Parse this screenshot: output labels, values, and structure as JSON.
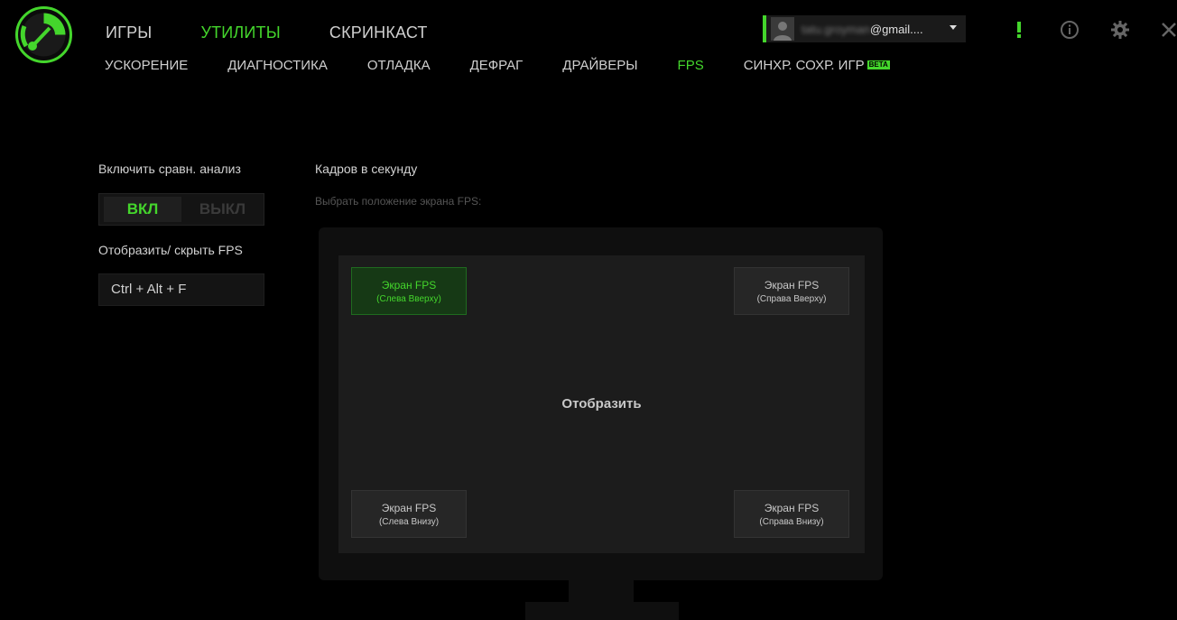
{
  "colors": {
    "accent": "#44d62c",
    "background": "#000000"
  },
  "top_nav": [
    {
      "label": "ИГРЫ",
      "active": false
    },
    {
      "label": "УТИЛИТЫ",
      "active": true
    },
    {
      "label": "СКРИНКАСТ",
      "active": false
    }
  ],
  "sub_nav": {
    "items": [
      {
        "label": "УСКОРЕНИЕ"
      },
      {
        "label": "ДИАГНОСТИКА"
      },
      {
        "label": "ОТЛАДКА"
      },
      {
        "label": "ДЕФРАГ"
      },
      {
        "label": "ДРАЙВЕРЫ"
      },
      {
        "label": "FPS"
      },
      {
        "label": "СИНХР. СОХР. ИГР"
      }
    ],
    "beta_badge": "BETA"
  },
  "account": {
    "email_user": "tatu.groyman",
    "email_domain": "@gmail...."
  },
  "icons": [
    "alert-icon",
    "info-icon",
    "gear-icon",
    "close-icon"
  ],
  "benchmark": {
    "label": "Включить сравн. анализ",
    "on_label": "ВКЛ",
    "off_label": "ВЫКЛ"
  },
  "toggle_fps": {
    "label": "Отобразить/ скрыть FPS",
    "hotkey": "Ctrl + Alt + F"
  },
  "fps": {
    "title": "Кадров в секунду",
    "position_label": "Выбрать положение экрана FPS:",
    "center_label": "Отобразить",
    "positions": {
      "top_left": {
        "title": "Экран FPS",
        "sub": "(Слева Вверху)"
      },
      "top_right": {
        "title": "Экран FPS",
        "sub": "(Справа Вверху)"
      },
      "bottom_left": {
        "title": "Экран FPS",
        "sub": "(Слева Внизу)"
      },
      "bottom_right": {
        "title": "Экран FPS",
        "sub": "(Справа Внизу)"
      }
    }
  }
}
